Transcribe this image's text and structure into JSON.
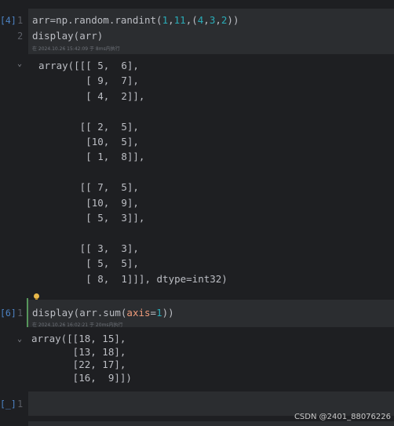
{
  "cells": [
    {
      "exec_count": "[4]",
      "lines": [
        "1",
        "2"
      ],
      "code_line1_a": "arr=np.random.randint(",
      "code_line1_n1": "1",
      "code_line1_c1": ",",
      "code_line1_n2": "11",
      "code_line1_c2": ",(",
      "code_line1_n3": "4",
      "code_line1_c3": ",",
      "code_line1_n4": "3",
      "code_line1_c4": ",",
      "code_line1_n5": "2",
      "code_line1_end": "))",
      "code_line2": "display(arr)",
      "meta": "在 2024.10.26 15:42:09 于 8ms内执行",
      "output_lines": [
        "array([[[ 5,  6],",
        "        [ 9,  7],",
        "        [ 4,  2]],",
        "",
        "       [[ 2,  5],",
        "        [10,  5],",
        "        [ 1,  8]],",
        "",
        "       [[ 7,  5],",
        "        [10,  9],",
        "        [ 5,  3]],",
        "",
        "       [[ 3,  3],",
        "        [ 5,  5],",
        "        [ 8,  1]]], dtype=int32)"
      ]
    },
    {
      "exec_count": "[6]",
      "line": "1",
      "code_a": "display(arr.sum(",
      "code_kw": "axis",
      "code_eq": "=",
      "code_n": "1",
      "code_end": "))",
      "meta": "在 2024.10.26 16:02:21 于 20ms内执行",
      "output_lines": [
        "array([[18, 15],",
        "       [13, 18],",
        "       [22, 17],",
        "       [16,  9]])"
      ]
    },
    {
      "exec_count": "[_]",
      "line": "1"
    }
  ],
  "icons": {
    "chevron": "chevron-down-icon",
    "bulb": "lightbulb-icon"
  },
  "watermark": "CSDN @2401_88076226"
}
